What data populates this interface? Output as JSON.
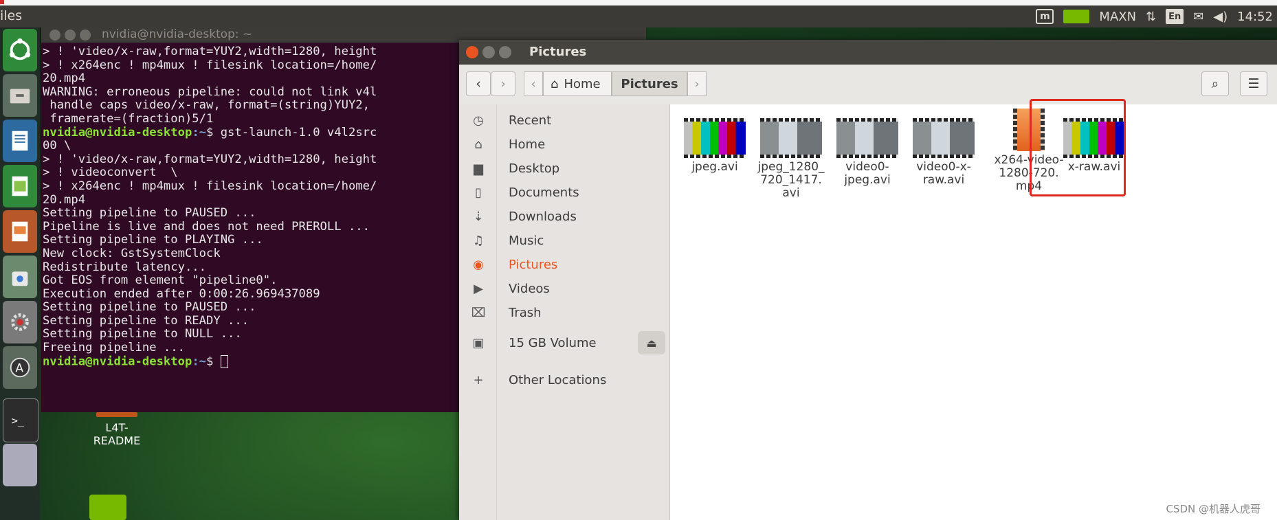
{
  "top_strip": {},
  "top_panel": {
    "app_name": "iles",
    "tray": {
      "indicator_label": "m",
      "power_mode": "MAXN",
      "language": "En",
      "time": "14:52"
    }
  },
  "terminal": {
    "title": "nvidia@nvidia-desktop: ~",
    "lines": [
      "> ! 'video/x-raw,format=YUY2,width=1280, height",
      "> ! x264enc ! mp4mux ! filesink location=/home/",
      "20.mp4",
      "WARNING: erroneous pipeline: could not link v4l",
      " handle caps video/x-raw, format=(string)YUY2,",
      " framerate=(fraction)5/1"
    ],
    "prompt1": {
      "user": "nvidia@nvidia-desktop",
      "path": ":~",
      "cmd": "$ gst-launch-1.0 v4l2src"
    },
    "lines2": [
      "00 \\",
      "> ! 'video/x-raw,format=YUY2,width=1280, height",
      "> ! videoconvert  \\",
      "> ! x264enc ! mp4mux ! filesink location=/home/",
      "20.mp4",
      "Setting pipeline to PAUSED ...",
      "Pipeline is live and does not need PREROLL ...",
      "Setting pipeline to PLAYING ...",
      "New clock: GstSystemClock",
      "Redistribute latency...",
      "Got EOS from element \"pipeline0\".",
      "Execution ended after 0:00:26.969437089",
      "Setting pipeline to PAUSED ...",
      "Setting pipeline to READY ...",
      "Setting pipeline to NULL ...",
      "Freeing pipeline ..."
    ],
    "prompt2": {
      "user": "nvidia@nvidia-desktop",
      "path": ":~",
      "cmd": "$ "
    }
  },
  "desktop_icon": {
    "label_line1": "L4T-",
    "label_line2": "README"
  },
  "files_window": {
    "title": "Pictures",
    "breadcrumb": {
      "home": "Home",
      "current": "Pictures"
    },
    "sidebar": [
      {
        "label": "Recent",
        "icon": "clock-icon",
        "glyph": "◷"
      },
      {
        "label": "Home",
        "icon": "home-icon",
        "glyph": "⌂"
      },
      {
        "label": "Desktop",
        "icon": "folder-icon",
        "glyph": "▆"
      },
      {
        "label": "Documents",
        "icon": "document-icon",
        "glyph": "▯"
      },
      {
        "label": "Downloads",
        "icon": "download-icon",
        "glyph": "⇣"
      },
      {
        "label": "Music",
        "icon": "music-icon",
        "glyph": "♫"
      },
      {
        "label": "Pictures",
        "icon": "camera-icon",
        "glyph": "◉"
      },
      {
        "label": "Videos",
        "icon": "video-icon",
        "glyph": "▶"
      },
      {
        "label": "Trash",
        "icon": "trash-icon",
        "glyph": "⌧"
      },
      {
        "label": "15 GB Volume",
        "icon": "drive-icon",
        "glyph": "▣"
      },
      {
        "label": "Other Locations",
        "icon": "plus-icon",
        "glyph": "+"
      }
    ],
    "files": [
      {
        "name_l1": "jpeg.avi",
        "name_l2": "",
        "name_l3": "",
        "thumb": "bars"
      },
      {
        "name_l1": "jpeg_1280_",
        "name_l2": "720_1417.",
        "name_l3": "avi",
        "thumb": "room"
      },
      {
        "name_l1": "video0-",
        "name_l2": "jpeg.avi",
        "name_l3": "",
        "thumb": "room"
      },
      {
        "name_l1": "video0-x-",
        "name_l2": "raw.avi",
        "name_l3": "",
        "thumb": "room"
      },
      {
        "name_l1": "x264-video-",
        "name_l2": "1280-720.",
        "name_l3": "mp4",
        "thumb": "mp4"
      },
      {
        "name_l1": "x-raw.avi",
        "name_l2": "",
        "name_l3": "",
        "thumb": "bars"
      }
    ]
  },
  "colors": {
    "accent": "#e95420",
    "terminal_bg": "#300a24",
    "highlight": "#e0281e",
    "nvidia_green": "#76b900"
  },
  "watermark": "CSDN @机器人虎哥"
}
